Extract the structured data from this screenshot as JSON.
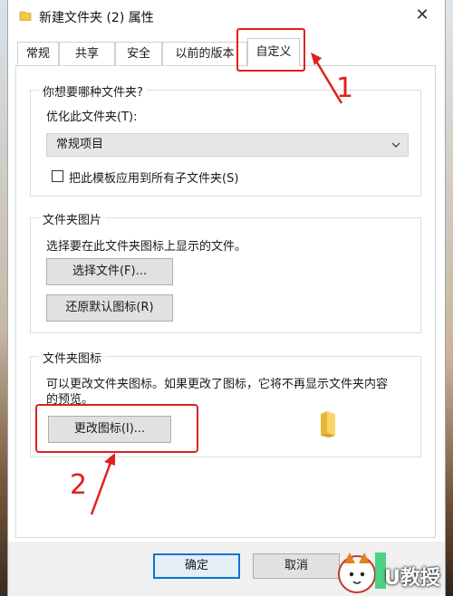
{
  "window": {
    "title": "新建文件夹 (2) 属性",
    "close_glyph": "✕"
  },
  "tabs": [
    {
      "label": "常规",
      "active": false
    },
    {
      "label": "共享",
      "active": false
    },
    {
      "label": "安全",
      "active": false
    },
    {
      "label": "以前的版本",
      "active": false
    },
    {
      "label": "自定义",
      "active": true
    }
  ],
  "section_type": {
    "title": "你想要哪种文件夹?",
    "optimize_label": "优化此文件夹(T):",
    "optimize_value": "常规项目",
    "apply_subfolders_label": "把此模板应用到所有子文件夹(S)",
    "apply_subfolders_checked": false
  },
  "section_pictures": {
    "title": "文件夹图片",
    "description": "选择要在此文件夹图标上显示的文件。",
    "choose_file_button": "选择文件(F)...",
    "restore_default_button": "还原默认图标(R)"
  },
  "section_icons": {
    "title": "文件夹图标",
    "description_line1": "可以更改文件夹图标。如果更改了图标，它将不再显示文件夹内容",
    "description_line2": "的预览。",
    "change_icon_button": "更改图标(I)..."
  },
  "footer": {
    "ok_button": "确定",
    "cancel_button": "取消"
  },
  "annotations": {
    "step1": "1",
    "step2": "2",
    "color": "#e02020"
  },
  "watermark": {
    "text": "U教授"
  },
  "icons": {
    "title_icon": "folder-icon",
    "select_arrow": "chevron-down-icon",
    "preview": "folder-icon"
  }
}
